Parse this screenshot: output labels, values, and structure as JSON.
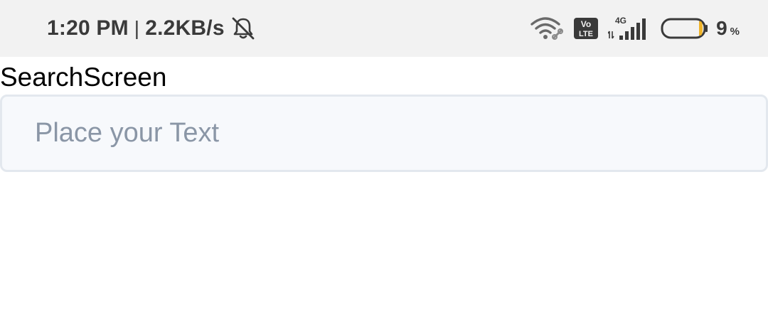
{
  "status_bar": {
    "time": "1:20 PM",
    "separator": "|",
    "network_speed": "2.2KB/s",
    "mute_icon": "bell-off-icon",
    "wifi_icon": "wifi-icon",
    "volte_icon": "volte-icon",
    "volte_top": "Vo",
    "volte_bottom": "LTE",
    "network_type": "4G",
    "signal_icon": "signal-bars-icon",
    "battery_icon": "battery-icon",
    "battery_level": 0.09,
    "battery_value": "9",
    "battery_unit": "%",
    "battery_fill_color": "#f0b429"
  },
  "screen": {
    "title": "SearchScreen"
  },
  "search": {
    "value": "",
    "placeholder": "Place your Text"
  }
}
